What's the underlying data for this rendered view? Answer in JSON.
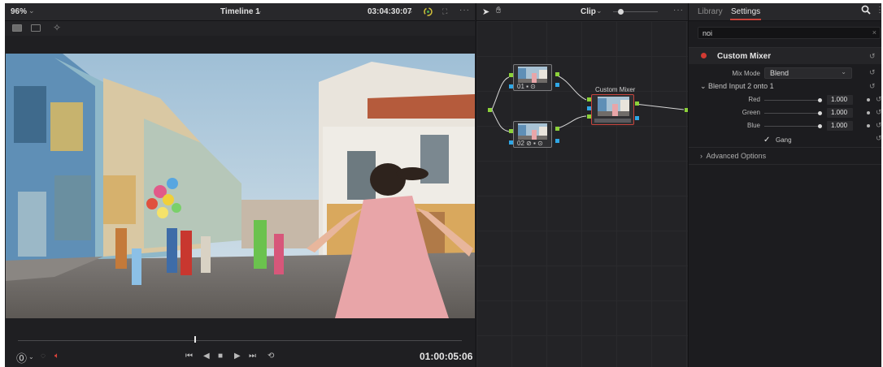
{
  "viewer": {
    "zoom": "96%",
    "timeline_name": "Timeline 1",
    "source_timecode": "03:04:30:07",
    "playback_timecode": "01:00:05:06",
    "more": "···"
  },
  "node_editor": {
    "clip_mode": "Clip",
    "more": "···",
    "nodes": [
      {
        "label": "01 ▪ ⊙"
      },
      {
        "label": "02 ⊘ ▪ ⊙"
      }
    ],
    "mixer_title": "Custom Mixer"
  },
  "inspector": {
    "tabs": [
      "Library",
      "Settings"
    ],
    "active_tab": "Settings",
    "more": "⋮",
    "search_value": "noi",
    "effect_name": "Custom Mixer",
    "mix_mode_label": "Mix Mode",
    "mix_mode_value": "Blend",
    "group_title": "Blend Input 2 onto 1",
    "params": [
      {
        "label": "Red",
        "value": "1.000"
      },
      {
        "label": "Green",
        "value": "1.000"
      },
      {
        "label": "Blue",
        "value": "1.000"
      }
    ],
    "gang_label": "Gang",
    "advanced_label": "Advanced Options"
  },
  "colors": {
    "accent_red": "#c8443c",
    "port_green": "#8cd13a",
    "port_blue": "#2fa7e6"
  }
}
